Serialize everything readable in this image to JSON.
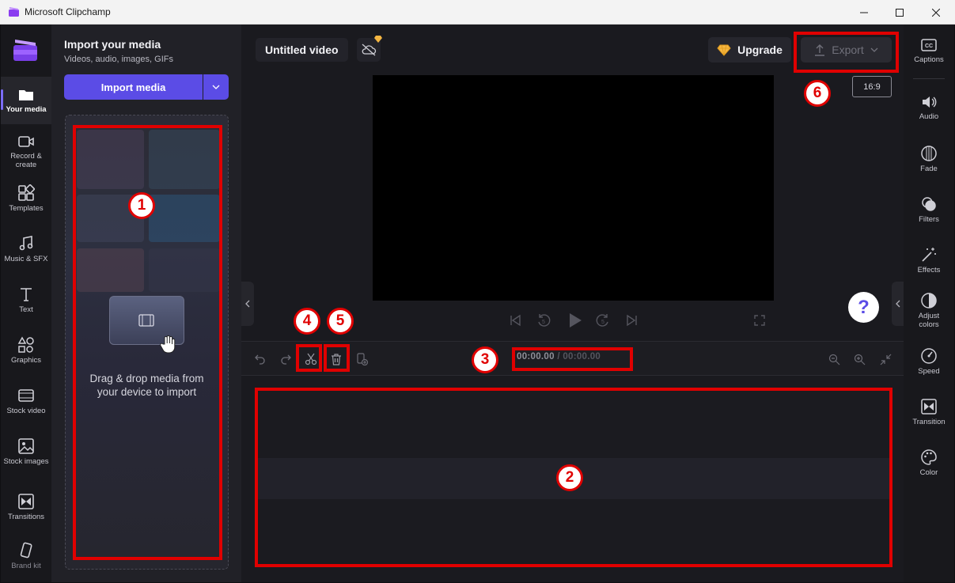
{
  "window": {
    "title": "Microsoft Clipchamp"
  },
  "left_nav": {
    "items": [
      {
        "label": "Your media",
        "icon": "folder-icon"
      },
      {
        "label": "Record & create",
        "icon": "camera-icon"
      },
      {
        "label": "Templates",
        "icon": "templates-icon"
      },
      {
        "label": "Music & SFX",
        "icon": "music-icon"
      },
      {
        "label": "Text",
        "icon": "text-icon"
      },
      {
        "label": "Graphics",
        "icon": "graphics-icon"
      },
      {
        "label": "Stock video",
        "icon": "film-icon"
      },
      {
        "label": "Stock images",
        "icon": "image-icon"
      },
      {
        "label": "Transitions",
        "icon": "transitions-icon"
      },
      {
        "label": "Brand kit",
        "icon": "brand-kit-icon"
      }
    ]
  },
  "media_panel": {
    "title": "Import your media",
    "subtitle": "Videos, audio, images, GIFs",
    "import_label": "Import media",
    "drop_text_line1": "Drag & drop media from",
    "drop_text_line2": "your device to import"
  },
  "header": {
    "project_title": "Untitled video",
    "upgrade_label": "Upgrade",
    "export_label": "Export",
    "aspect_ratio": "16:9"
  },
  "timeline": {
    "current_time": "00:00.00",
    "separator": "/",
    "total_time": "00:00.00"
  },
  "help": {
    "label": "?"
  },
  "right_nav": {
    "items": [
      {
        "label": "Captions",
        "icon": "captions-icon"
      },
      {
        "label": "Audio",
        "icon": "speaker-icon"
      },
      {
        "label": "Fade",
        "icon": "fade-icon"
      },
      {
        "label": "Filters",
        "icon": "filters-icon"
      },
      {
        "label": "Effects",
        "icon": "magic-wand-icon"
      },
      {
        "label": "Adjust colors",
        "icon": "contrast-icon"
      },
      {
        "label": "Speed",
        "icon": "speedometer-icon"
      },
      {
        "label": "Transition",
        "icon": "transition-icon"
      },
      {
        "label": "Color",
        "icon": "palette-icon"
      }
    ]
  },
  "annotations": [
    "1",
    "2",
    "3",
    "4",
    "5",
    "6"
  ],
  "colors": {
    "accent": "#5b4ce6",
    "highlight": "#e00000"
  }
}
